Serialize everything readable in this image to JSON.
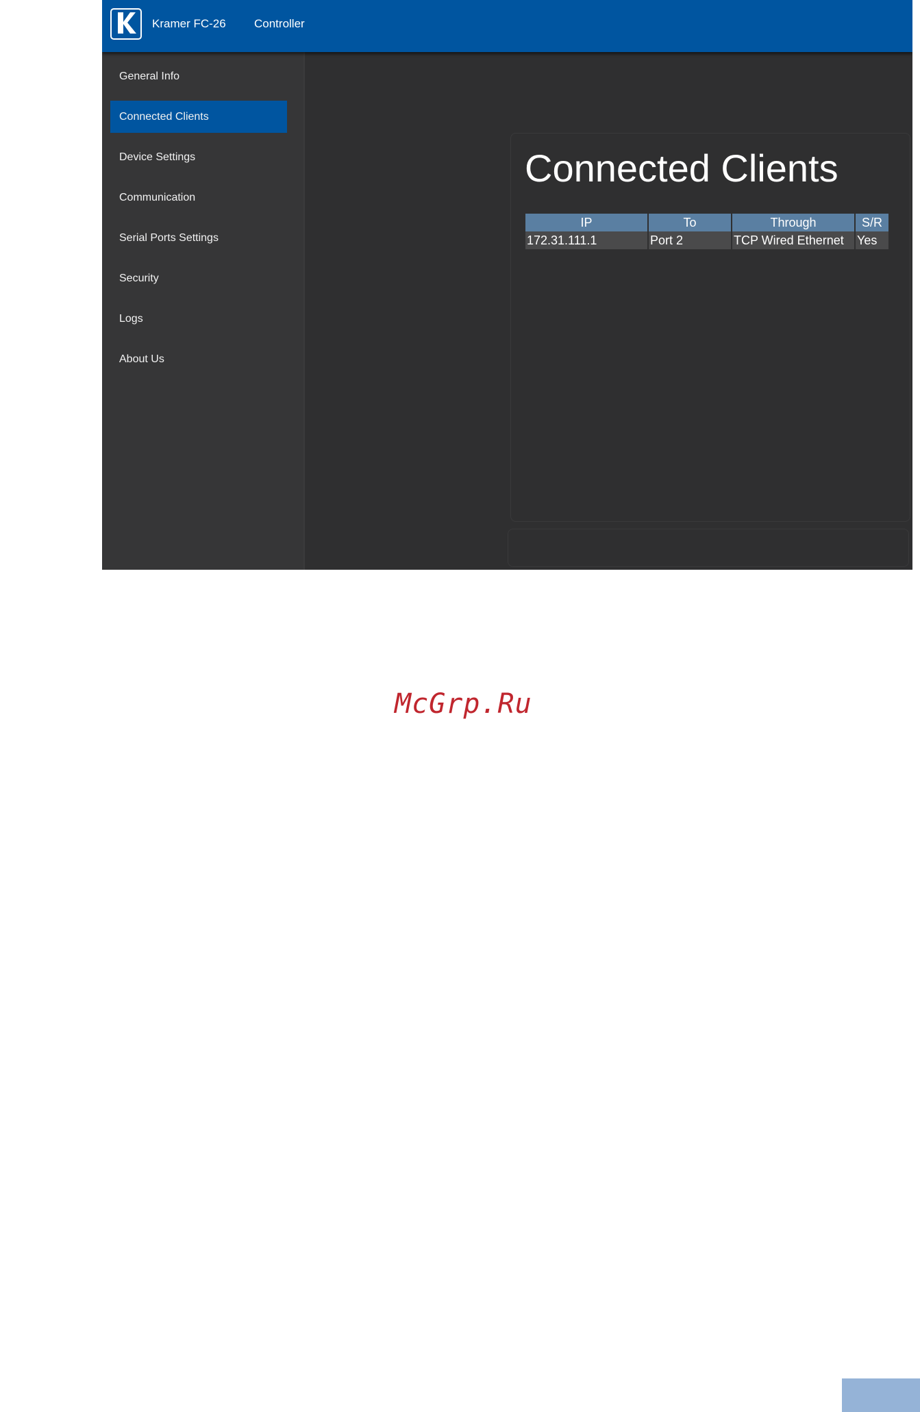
{
  "header": {
    "title": "Kramer FC-26",
    "role": "Controller",
    "logo_text": "KRAMER"
  },
  "sidebar": {
    "items": [
      {
        "label": "General Info"
      },
      {
        "label": "Connected Clients",
        "active": true
      },
      {
        "label": "Device Settings"
      },
      {
        "label": "Communication"
      },
      {
        "label": "Serial Ports Settings"
      },
      {
        "label": "Security"
      },
      {
        "label": "Logs"
      },
      {
        "label": "About Us"
      }
    ]
  },
  "main": {
    "title": "Connected Clients",
    "table": {
      "columns": [
        "IP",
        "To",
        "Through",
        "S/R"
      ],
      "rows": [
        [
          "172.31.111.1",
          "Port 2",
          "TCP Wired Ethernet",
          "Yes"
        ]
      ]
    }
  },
  "page": {
    "watermark": "McGrp.Ru"
  },
  "colors": {
    "brand_blue": "#0055a0",
    "table_header": "#5a7fa2",
    "background_dark": "#2f2f30",
    "watermark_red": "#c0262e",
    "page_tab": "#95b3d7"
  }
}
